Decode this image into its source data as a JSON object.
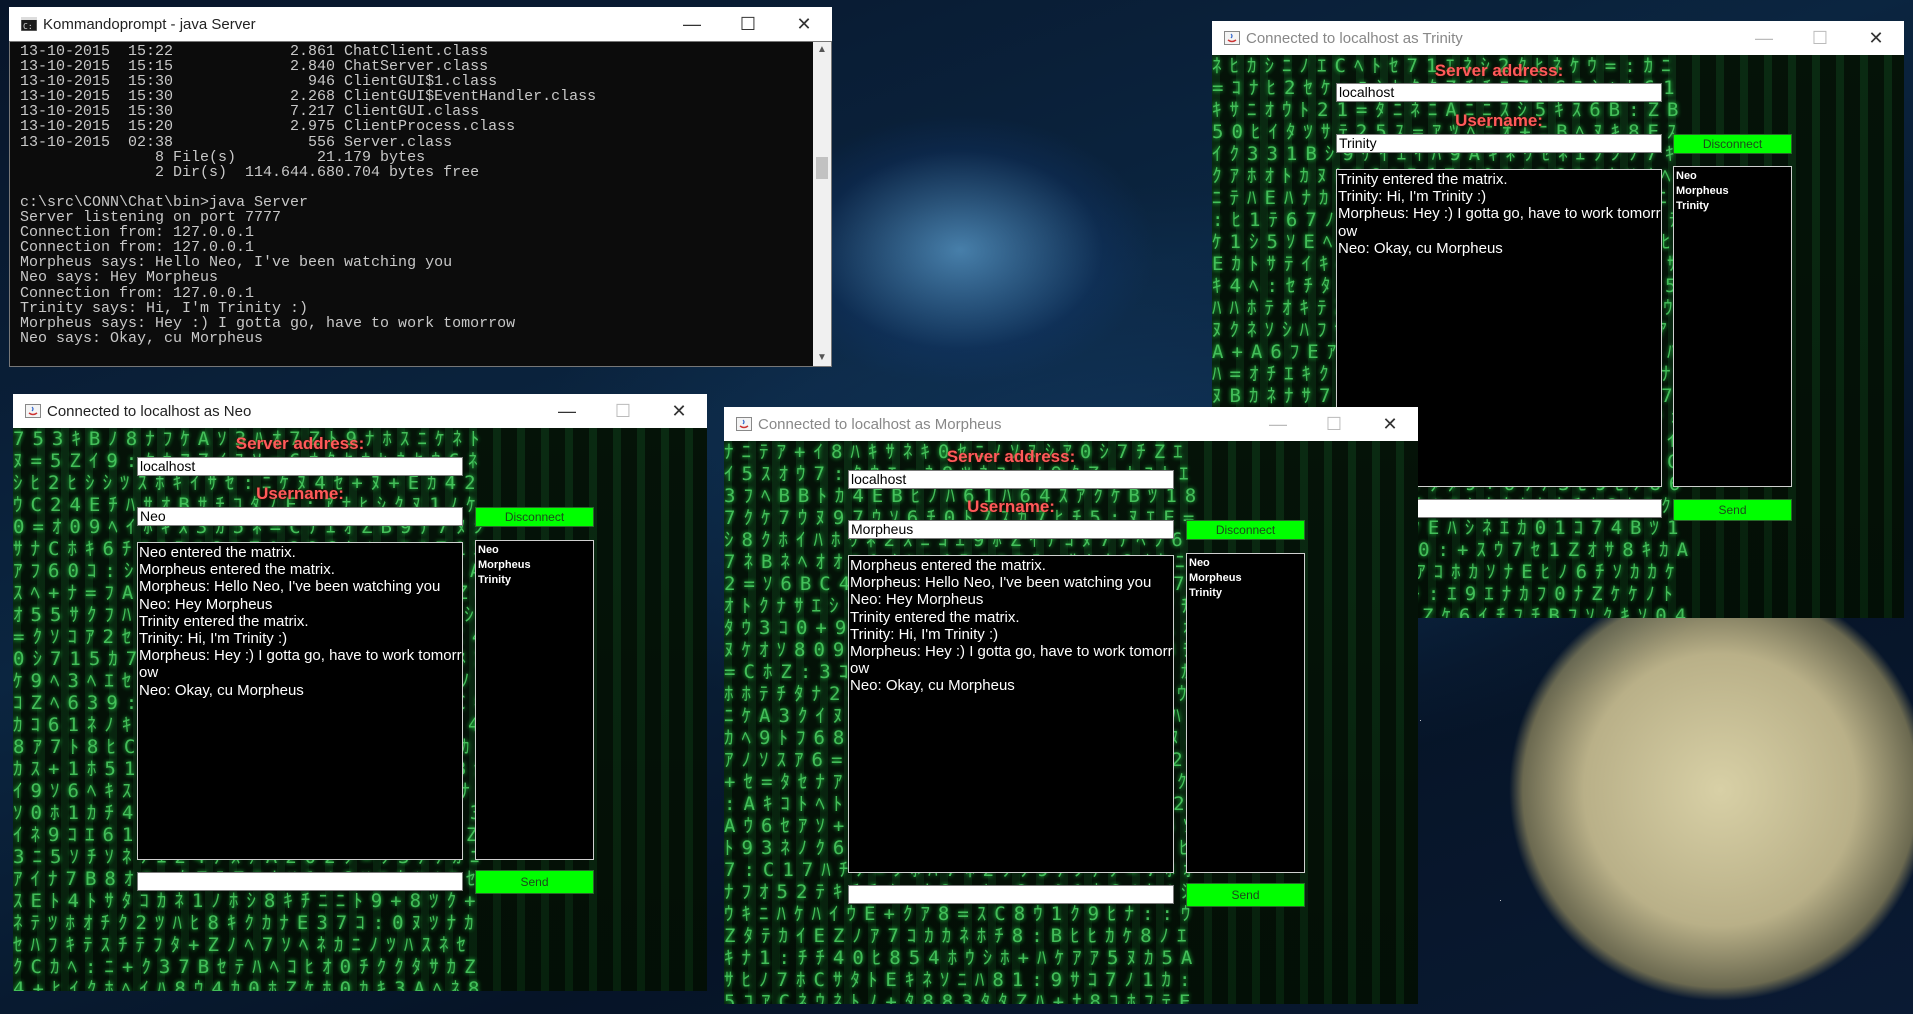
{
  "console": {
    "title": "Kommandoprompt - java  Server",
    "lines": [
      "13-10-2015  15:22             2.861 ChatClient.class",
      "13-10-2015  15:15             2.840 ChatServer.class",
      "13-10-2015  15:30               946 ClientGUI$1.class",
      "13-10-2015  15:30             2.268 ClientGUI$EventHandler.class",
      "13-10-2015  15:30             7.217 ClientGUI.class",
      "13-10-2015  15:20             2.975 ClientProcess.class",
      "13-10-2015  02:38               556 Server.class",
      "               8 File(s)         21.179 bytes",
      "               2 Dir(s)  114.644.680.704 bytes free",
      "",
      "c:\\src\\CONN\\Chat\\bin>java Server",
      "Server listening on port 7777",
      "Connection from: 127.0.0.1",
      "Connection from: 127.0.0.1",
      "Morpheus says: Hello Neo, I've been watching you",
      "Neo says: Hey Morpheus",
      "Connection from: 127.0.0.1",
      "Trinity says: Hi, I'm Trinity :)",
      "Morpheus says: Hey :) I gotta go, have to work tomorrow",
      "Neo says: Okay, cu Morpheus"
    ]
  },
  "window_controls": {
    "minimize": "—",
    "maximize": "☐",
    "close": "✕"
  },
  "clients": [
    {
      "id": "neo",
      "title": "Connected to localhost as Neo",
      "server_label": "Server address:",
      "server_value": "localhost",
      "username_label": "Username:",
      "username_value": "Neo",
      "disconnect_label": "Disconnect",
      "send_label": "Send",
      "message_input": "",
      "messages": [
        "Neo entered the matrix.",
        "Morpheus entered the matrix.",
        "Morpheus: Hello Neo, I've been watching you",
        "Neo: Hey Morpheus",
        "Trinity entered the matrix.",
        "Trinity: Hi, I'm Trinity :)",
        "Morpheus: Hey :) I gotta go, have to work tomorrow",
        "Neo: Okay, cu Morpheus"
      ],
      "users": [
        "Neo",
        "Morpheus",
        "Trinity"
      ]
    },
    {
      "id": "morpheus",
      "title": "Connected to localhost as Morpheus",
      "server_label": "Server address:",
      "server_value": "localhost",
      "username_label": "Username:",
      "username_value": "Morpheus",
      "disconnect_label": "Disconnect",
      "send_label": "Send",
      "message_input": "",
      "messages": [
        "Morpheus entered the matrix.",
        "Morpheus: Hello Neo, I've been watching you",
        "Neo: Hey Morpheus",
        "Trinity entered the matrix.",
        "Trinity: Hi, I'm Trinity :)",
        "Morpheus: Hey :) I gotta go, have to work tomorrow",
        "Neo: Okay, cu Morpheus"
      ],
      "users": [
        "Neo",
        "Morpheus",
        "Trinity"
      ]
    },
    {
      "id": "trinity",
      "title": "Connected to localhost as Trinity",
      "server_label": "Server address:",
      "server_value": "localhost",
      "username_label": "Username:",
      "username_value": "Trinity",
      "disconnect_label": "Disconnect",
      "send_label": "Send",
      "message_input": "",
      "messages": [
        "Trinity entered the matrix.",
        "Trinity: Hi, I'm Trinity :)",
        "Morpheus: Hey :) I gotta go, have to work tomorrow",
        "Neo: Okay, cu Morpheus"
      ],
      "users": [
        "Neo",
        "Morpheus",
        "Trinity"
      ]
    }
  ],
  "colors": {
    "button_green": "#00ff00",
    "label_red": "#ff5a5a",
    "matrix_green": "#4fdc68"
  }
}
